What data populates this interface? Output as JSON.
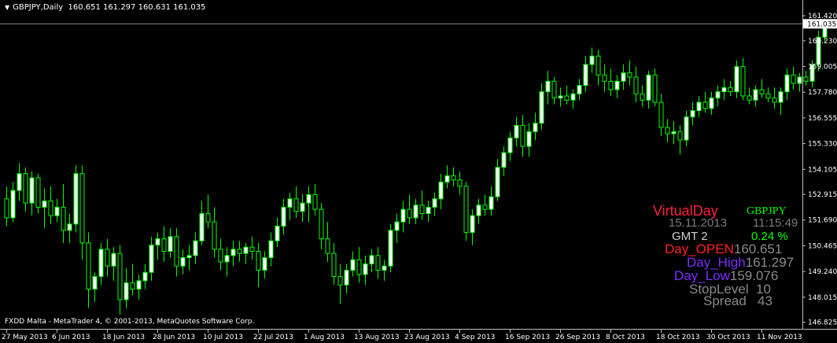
{
  "chart_data": {
    "type": "candlestick",
    "header": {
      "symbol_timeframe": "GBPJPY,Daily",
      "ohlc_text": "160.651 161.297 160.631 161.035"
    },
    "footer_text": "FXDD Malta - MetaTrader 4, © 2001-2013, MetaQuotes Software Corp.",
    "current_price_label": "161.035",
    "current_price": 161.035,
    "ylim": [
      146.66,
      161.72
    ],
    "y_ticks": [
      "161.420",
      "160.230",
      "159.005",
      "157.780",
      "156.555",
      "155.330",
      "154.105",
      "152.915",
      "151.690",
      "150.465",
      "149.240",
      "148.015",
      "146.825"
    ],
    "y_tick_values": [
      161.42,
      160.23,
      159.005,
      157.78,
      156.555,
      155.33,
      154.105,
      152.915,
      151.69,
      150.465,
      149.24,
      148.015,
      146.825
    ],
    "x_ticks": [
      "27 May 2013",
      "6 Jun 2013",
      "18 Jun 2013",
      "28 Jun 2013",
      "10 Jul 2013",
      "22 Jul 2013",
      "1 Aug 2013",
      "13 Aug 2013",
      "23 Aug 2013",
      "4 Sep 2013",
      "16 Sep 2013",
      "26 Sep 2013",
      "8 Oct 2013",
      "18 Oct 2013",
      "30 Oct 2013",
      "11 Nov 2013"
    ],
    "x_tick_index": [
      0,
      8,
      16,
      24,
      32,
      40,
      48,
      56,
      64,
      72,
      80,
      88,
      96,
      104,
      112,
      120
    ],
    "bull_color": "#ffffff",
    "bear_color": "#000000",
    "wick_color": "#00ff00",
    "candles": [
      {
        "o": 152.7,
        "h": 153.3,
        "l": 151.4,
        "c": 151.8
      },
      {
        "o": 151.8,
        "h": 153.5,
        "l": 151.6,
        "c": 153.1
      },
      {
        "o": 153.1,
        "h": 154.4,
        "l": 152.6,
        "c": 153.9
      },
      {
        "o": 153.9,
        "h": 154.2,
        "l": 152.1,
        "c": 152.5
      },
      {
        "o": 152.5,
        "h": 154.0,
        "l": 151.9,
        "c": 153.7
      },
      {
        "o": 153.7,
        "h": 153.9,
        "l": 152.0,
        "c": 152.3
      },
      {
        "o": 152.3,
        "h": 153.2,
        "l": 151.3,
        "c": 152.6
      },
      {
        "o": 152.6,
        "h": 153.3,
        "l": 151.5,
        "c": 151.9
      },
      {
        "o": 151.9,
        "h": 152.7,
        "l": 151.6,
        "c": 152.3
      },
      {
        "o": 152.3,
        "h": 153.4,
        "l": 150.6,
        "c": 151.2
      },
      {
        "o": 151.2,
        "h": 152.0,
        "l": 150.6,
        "c": 151.5
      },
      {
        "o": 151.5,
        "h": 154.3,
        "l": 151.1,
        "c": 153.9
      },
      {
        "o": 153.9,
        "h": 154.3,
        "l": 149.8,
        "c": 150.6
      },
      {
        "o": 150.6,
        "h": 151.1,
        "l": 147.5,
        "c": 148.4
      },
      {
        "o": 148.4,
        "h": 149.2,
        "l": 147.8,
        "c": 149.0
      },
      {
        "o": 149.0,
        "h": 150.6,
        "l": 148.6,
        "c": 150.3
      },
      {
        "o": 150.3,
        "h": 150.8,
        "l": 149.0,
        "c": 149.5
      },
      {
        "o": 149.5,
        "h": 150.4,
        "l": 148.8,
        "c": 150.1
      },
      {
        "o": 150.1,
        "h": 150.5,
        "l": 147.2,
        "c": 147.9
      },
      {
        "o": 147.9,
        "h": 149.4,
        "l": 147.5,
        "c": 148.7
      },
      {
        "o": 148.7,
        "h": 149.6,
        "l": 148.1,
        "c": 148.4
      },
      {
        "o": 148.4,
        "h": 149.1,
        "l": 147.9,
        "c": 148.8
      },
      {
        "o": 148.8,
        "h": 149.6,
        "l": 148.4,
        "c": 149.2
      },
      {
        "o": 149.2,
        "h": 150.9,
        "l": 148.8,
        "c": 150.5
      },
      {
        "o": 150.5,
        "h": 151.1,
        "l": 149.8,
        "c": 150.8
      },
      {
        "o": 150.8,
        "h": 151.4,
        "l": 149.7,
        "c": 150.2
      },
      {
        "o": 150.2,
        "h": 151.3,
        "l": 149.9,
        "c": 150.9
      },
      {
        "o": 150.9,
        "h": 151.3,
        "l": 149.0,
        "c": 149.5
      },
      {
        "o": 149.5,
        "h": 150.3,
        "l": 149.1,
        "c": 149.9
      },
      {
        "o": 149.9,
        "h": 150.5,
        "l": 149.3,
        "c": 150.0
      },
      {
        "o": 150.0,
        "h": 151.1,
        "l": 149.6,
        "c": 150.7
      },
      {
        "o": 150.7,
        "h": 152.6,
        "l": 150.5,
        "c": 152.0
      },
      {
        "o": 152.0,
        "h": 152.9,
        "l": 151.3,
        "c": 151.6
      },
      {
        "o": 151.6,
        "h": 152.3,
        "l": 149.9,
        "c": 150.3
      },
      {
        "o": 150.3,
        "h": 150.8,
        "l": 149.3,
        "c": 149.7
      },
      {
        "o": 149.7,
        "h": 150.4,
        "l": 149.0,
        "c": 150.0
      },
      {
        "o": 150.0,
        "h": 150.7,
        "l": 149.5,
        "c": 150.3
      },
      {
        "o": 150.3,
        "h": 150.7,
        "l": 149.7,
        "c": 150.1
      },
      {
        "o": 150.1,
        "h": 150.6,
        "l": 149.6,
        "c": 150.4
      },
      {
        "o": 150.4,
        "h": 150.9,
        "l": 149.8,
        "c": 150.2
      },
      {
        "o": 150.2,
        "h": 150.6,
        "l": 148.5,
        "c": 149.3
      },
      {
        "o": 149.3,
        "h": 150.2,
        "l": 148.9,
        "c": 149.9
      },
      {
        "o": 149.9,
        "h": 151.1,
        "l": 149.5,
        "c": 150.7
      },
      {
        "o": 150.7,
        "h": 151.8,
        "l": 150.4,
        "c": 151.4
      },
      {
        "o": 151.4,
        "h": 152.7,
        "l": 151.0,
        "c": 152.3
      },
      {
        "o": 152.3,
        "h": 153.0,
        "l": 151.7,
        "c": 152.7
      },
      {
        "o": 152.7,
        "h": 153.3,
        "l": 151.8,
        "c": 152.1
      },
      {
        "o": 152.1,
        "h": 152.9,
        "l": 151.6,
        "c": 152.5
      },
      {
        "o": 152.5,
        "h": 153.3,
        "l": 151.6,
        "c": 152.9
      },
      {
        "o": 152.9,
        "h": 153.4,
        "l": 151.9,
        "c": 152.2
      },
      {
        "o": 152.2,
        "h": 152.5,
        "l": 150.3,
        "c": 150.8
      },
      {
        "o": 150.8,
        "h": 151.6,
        "l": 149.7,
        "c": 150.1
      },
      {
        "o": 150.1,
        "h": 150.6,
        "l": 148.6,
        "c": 149.0
      },
      {
        "o": 149.0,
        "h": 149.6,
        "l": 147.7,
        "c": 148.6
      },
      {
        "o": 148.6,
        "h": 149.6,
        "l": 148.2,
        "c": 149.3
      },
      {
        "o": 149.3,
        "h": 150.2,
        "l": 149.0,
        "c": 149.8
      },
      {
        "o": 149.8,
        "h": 150.4,
        "l": 148.7,
        "c": 149.1
      },
      {
        "o": 149.1,
        "h": 150.0,
        "l": 148.6,
        "c": 149.6
      },
      {
        "o": 149.6,
        "h": 150.3,
        "l": 149.2,
        "c": 150.0
      },
      {
        "o": 150.0,
        "h": 150.4,
        "l": 148.9,
        "c": 149.3
      },
      {
        "o": 149.3,
        "h": 149.8,
        "l": 148.8,
        "c": 149.5
      },
      {
        "o": 149.5,
        "h": 151.5,
        "l": 149.2,
        "c": 151.2
      },
      {
        "o": 151.2,
        "h": 152.0,
        "l": 150.6,
        "c": 151.6
      },
      {
        "o": 151.6,
        "h": 152.6,
        "l": 151.1,
        "c": 152.2
      },
      {
        "o": 152.2,
        "h": 152.9,
        "l": 151.5,
        "c": 151.8
      },
      {
        "o": 151.8,
        "h": 152.7,
        "l": 151.5,
        "c": 152.4
      },
      {
        "o": 152.4,
        "h": 153.1,
        "l": 151.7,
        "c": 152.0
      },
      {
        "o": 152.0,
        "h": 152.6,
        "l": 151.6,
        "c": 152.3
      },
      {
        "o": 152.3,
        "h": 153.0,
        "l": 151.9,
        "c": 152.7
      },
      {
        "o": 152.7,
        "h": 153.9,
        "l": 152.2,
        "c": 153.5
      },
      {
        "o": 153.5,
        "h": 154.3,
        "l": 153.2,
        "c": 153.8
      },
      {
        "o": 153.8,
        "h": 154.2,
        "l": 153.3,
        "c": 153.6
      },
      {
        "o": 153.6,
        "h": 154.0,
        "l": 152.9,
        "c": 153.3
      },
      {
        "o": 153.3,
        "h": 153.5,
        "l": 150.7,
        "c": 151.1
      },
      {
        "o": 151.1,
        "h": 152.2,
        "l": 150.5,
        "c": 151.9
      },
      {
        "o": 151.9,
        "h": 152.7,
        "l": 151.5,
        "c": 152.4
      },
      {
        "o": 152.4,
        "h": 152.9,
        "l": 151.9,
        "c": 152.2
      },
      {
        "o": 152.2,
        "h": 153.3,
        "l": 151.9,
        "c": 152.8
      },
      {
        "o": 152.8,
        "h": 154.6,
        "l": 152.6,
        "c": 154.2
      },
      {
        "o": 154.2,
        "h": 155.2,
        "l": 153.8,
        "c": 154.9
      },
      {
        "o": 154.9,
        "h": 155.9,
        "l": 154.5,
        "c": 155.6
      },
      {
        "o": 155.6,
        "h": 156.6,
        "l": 155.2,
        "c": 156.2
      },
      {
        "o": 156.2,
        "h": 156.7,
        "l": 154.7,
        "c": 155.2
      },
      {
        "o": 155.2,
        "h": 156.3,
        "l": 154.7,
        "c": 155.9
      },
      {
        "o": 155.9,
        "h": 156.8,
        "l": 155.5,
        "c": 156.3
      },
      {
        "o": 156.3,
        "h": 158.2,
        "l": 156.0,
        "c": 157.8
      },
      {
        "o": 157.8,
        "h": 158.8,
        "l": 157.2,
        "c": 158.3
      },
      {
        "o": 158.3,
        "h": 158.5,
        "l": 157.2,
        "c": 157.5
      },
      {
        "o": 157.5,
        "h": 158.0,
        "l": 157.1,
        "c": 157.6
      },
      {
        "o": 157.6,
        "h": 158.1,
        "l": 157.2,
        "c": 157.4
      },
      {
        "o": 157.4,
        "h": 157.9,
        "l": 157.0,
        "c": 157.7
      },
      {
        "o": 157.7,
        "h": 158.4,
        "l": 157.4,
        "c": 158.1
      },
      {
        "o": 158.1,
        "h": 159.5,
        "l": 157.8,
        "c": 159.1
      },
      {
        "o": 159.1,
        "h": 159.9,
        "l": 158.7,
        "c": 159.5
      },
      {
        "o": 159.5,
        "h": 159.8,
        "l": 158.1,
        "c": 158.6
      },
      {
        "o": 158.6,
        "h": 159.1,
        "l": 157.8,
        "c": 158.3
      },
      {
        "o": 158.3,
        "h": 158.9,
        "l": 157.6,
        "c": 157.9
      },
      {
        "o": 157.9,
        "h": 158.6,
        "l": 157.5,
        "c": 158.3
      },
      {
        "o": 158.3,
        "h": 159.1,
        "l": 157.9,
        "c": 158.7
      },
      {
        "o": 158.7,
        "h": 159.3,
        "l": 158.1,
        "c": 158.5
      },
      {
        "o": 158.5,
        "h": 159.0,
        "l": 157.3,
        "c": 157.7
      },
      {
        "o": 157.7,
        "h": 158.1,
        "l": 157.1,
        "c": 157.4
      },
      {
        "o": 157.4,
        "h": 158.8,
        "l": 157.0,
        "c": 158.6
      },
      {
        "o": 158.6,
        "h": 158.9,
        "l": 157.1,
        "c": 157.3
      },
      {
        "o": 157.3,
        "h": 157.7,
        "l": 155.7,
        "c": 156.1
      },
      {
        "o": 156.1,
        "h": 156.5,
        "l": 155.4,
        "c": 155.8
      },
      {
        "o": 155.8,
        "h": 156.4,
        "l": 155.3,
        "c": 155.9
      },
      {
        "o": 155.9,
        "h": 156.2,
        "l": 154.8,
        "c": 155.5
      },
      {
        "o": 155.5,
        "h": 156.9,
        "l": 155.2,
        "c": 156.6
      },
      {
        "o": 156.6,
        "h": 157.3,
        "l": 156.2,
        "c": 156.9
      },
      {
        "o": 156.9,
        "h": 157.6,
        "l": 156.6,
        "c": 157.3
      },
      {
        "o": 157.3,
        "h": 157.8,
        "l": 156.8,
        "c": 157.0
      },
      {
        "o": 157.0,
        "h": 157.8,
        "l": 156.7,
        "c": 157.5
      },
      {
        "o": 157.5,
        "h": 158.1,
        "l": 157.1,
        "c": 157.8
      },
      {
        "o": 157.8,
        "h": 158.4,
        "l": 157.4,
        "c": 158.0
      },
      {
        "o": 158.0,
        "h": 158.3,
        "l": 157.6,
        "c": 157.8
      },
      {
        "o": 157.8,
        "h": 159.3,
        "l": 157.5,
        "c": 159.0
      },
      {
        "o": 159.0,
        "h": 159.4,
        "l": 157.4,
        "c": 157.6
      },
      {
        "o": 157.6,
        "h": 158.0,
        "l": 157.2,
        "c": 157.4
      },
      {
        "o": 157.4,
        "h": 158.1,
        "l": 157.1,
        "c": 157.9
      },
      {
        "o": 157.9,
        "h": 158.4,
        "l": 157.5,
        "c": 157.7
      },
      {
        "o": 157.7,
        "h": 158.0,
        "l": 157.3,
        "c": 157.5
      },
      {
        "o": 157.5,
        "h": 158.0,
        "l": 157.0,
        "c": 157.3
      },
      {
        "o": 157.3,
        "h": 158.0,
        "l": 156.7,
        "c": 157.8
      },
      {
        "o": 157.8,
        "h": 158.9,
        "l": 157.4,
        "c": 158.6
      },
      {
        "o": 158.6,
        "h": 159.0,
        "l": 157.9,
        "c": 158.2
      },
      {
        "o": 158.2,
        "h": 158.7,
        "l": 157.8,
        "c": 158.5
      },
      {
        "o": 158.5,
        "h": 158.8,
        "l": 158.1,
        "c": 158.3
      },
      {
        "o": 158.3,
        "h": 159.3,
        "l": 158.0,
        "c": 159.1
      },
      {
        "o": 159.1,
        "h": 160.7,
        "l": 158.8,
        "c": 160.4
      },
      {
        "o": 160.4,
        "h": 161.3,
        "l": 160.2,
        "c": 161.0
      }
    ]
  },
  "virtual_day": {
    "title": "VirtualDay",
    "symbol": "GBPJPY",
    "date": "15.11.2013",
    "time": "11:15:49",
    "gmt": "GMT 2",
    "percent": "0.24 %",
    "open_label": "Day_OPEN",
    "open_value": "160.651",
    "high_label": "Day_High",
    "high_value": "161.297",
    "low_label": "Day_Low",
    "low_value": "159.076",
    "stop_level": "StopLevel  10",
    "spread": "Spread   43"
  }
}
